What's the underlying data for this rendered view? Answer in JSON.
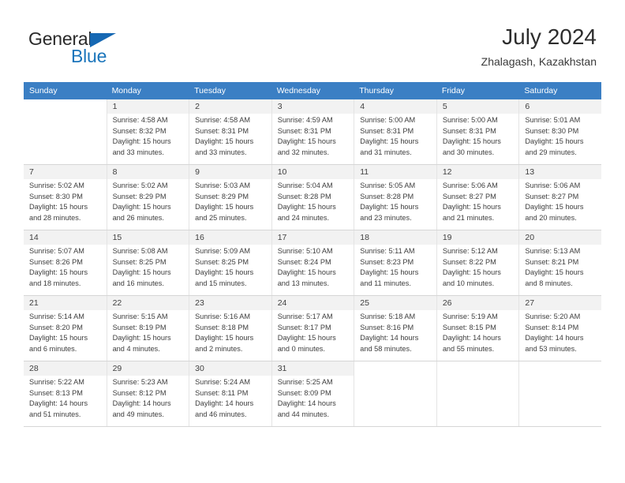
{
  "brand": {
    "name_part1": "General",
    "name_part2": "Blue",
    "accent_color": "#1b75bb",
    "triangle_icon": "logo-triangle-icon"
  },
  "header": {
    "title": "July 2024",
    "subtitle": "Zhalagash, Kazakhstan"
  },
  "calendar": {
    "header_bg": "#3b7fc4",
    "weekdays": [
      "Sunday",
      "Monday",
      "Tuesday",
      "Wednesday",
      "Thursday",
      "Friday",
      "Saturday"
    ],
    "weeks": [
      [
        {
          "day": "",
          "line1": "",
          "line2": "",
          "line3": "",
          "line4": ""
        },
        {
          "day": "1",
          "line1": "Sunrise: 4:58 AM",
          "line2": "Sunset: 8:32 PM",
          "line3": "Daylight: 15 hours",
          "line4": "and 33 minutes."
        },
        {
          "day": "2",
          "line1": "Sunrise: 4:58 AM",
          "line2": "Sunset: 8:31 PM",
          "line3": "Daylight: 15 hours",
          "line4": "and 33 minutes."
        },
        {
          "day": "3",
          "line1": "Sunrise: 4:59 AM",
          "line2": "Sunset: 8:31 PM",
          "line3": "Daylight: 15 hours",
          "line4": "and 32 minutes."
        },
        {
          "day": "4",
          "line1": "Sunrise: 5:00 AM",
          "line2": "Sunset: 8:31 PM",
          "line3": "Daylight: 15 hours",
          "line4": "and 31 minutes."
        },
        {
          "day": "5",
          "line1": "Sunrise: 5:00 AM",
          "line2": "Sunset: 8:31 PM",
          "line3": "Daylight: 15 hours",
          "line4": "and 30 minutes."
        },
        {
          "day": "6",
          "line1": "Sunrise: 5:01 AM",
          "line2": "Sunset: 8:30 PM",
          "line3": "Daylight: 15 hours",
          "line4": "and 29 minutes."
        }
      ],
      [
        {
          "day": "7",
          "line1": "Sunrise: 5:02 AM",
          "line2": "Sunset: 8:30 PM",
          "line3": "Daylight: 15 hours",
          "line4": "and 28 minutes."
        },
        {
          "day": "8",
          "line1": "Sunrise: 5:02 AM",
          "line2": "Sunset: 8:29 PM",
          "line3": "Daylight: 15 hours",
          "line4": "and 26 minutes."
        },
        {
          "day": "9",
          "line1": "Sunrise: 5:03 AM",
          "line2": "Sunset: 8:29 PM",
          "line3": "Daylight: 15 hours",
          "line4": "and 25 minutes."
        },
        {
          "day": "10",
          "line1": "Sunrise: 5:04 AM",
          "line2": "Sunset: 8:28 PM",
          "line3": "Daylight: 15 hours",
          "line4": "and 24 minutes."
        },
        {
          "day": "11",
          "line1": "Sunrise: 5:05 AM",
          "line2": "Sunset: 8:28 PM",
          "line3": "Daylight: 15 hours",
          "line4": "and 23 minutes."
        },
        {
          "day": "12",
          "line1": "Sunrise: 5:06 AM",
          "line2": "Sunset: 8:27 PM",
          "line3": "Daylight: 15 hours",
          "line4": "and 21 minutes."
        },
        {
          "day": "13",
          "line1": "Sunrise: 5:06 AM",
          "line2": "Sunset: 8:27 PM",
          "line3": "Daylight: 15 hours",
          "line4": "and 20 minutes."
        }
      ],
      [
        {
          "day": "14",
          "line1": "Sunrise: 5:07 AM",
          "line2": "Sunset: 8:26 PM",
          "line3": "Daylight: 15 hours",
          "line4": "and 18 minutes."
        },
        {
          "day": "15",
          "line1": "Sunrise: 5:08 AM",
          "line2": "Sunset: 8:25 PM",
          "line3": "Daylight: 15 hours",
          "line4": "and 16 minutes."
        },
        {
          "day": "16",
          "line1": "Sunrise: 5:09 AM",
          "line2": "Sunset: 8:25 PM",
          "line3": "Daylight: 15 hours",
          "line4": "and 15 minutes."
        },
        {
          "day": "17",
          "line1": "Sunrise: 5:10 AM",
          "line2": "Sunset: 8:24 PM",
          "line3": "Daylight: 15 hours",
          "line4": "and 13 minutes."
        },
        {
          "day": "18",
          "line1": "Sunrise: 5:11 AM",
          "line2": "Sunset: 8:23 PM",
          "line3": "Daylight: 15 hours",
          "line4": "and 11 minutes."
        },
        {
          "day": "19",
          "line1": "Sunrise: 5:12 AM",
          "line2": "Sunset: 8:22 PM",
          "line3": "Daylight: 15 hours",
          "line4": "and 10 minutes."
        },
        {
          "day": "20",
          "line1": "Sunrise: 5:13 AM",
          "line2": "Sunset: 8:21 PM",
          "line3": "Daylight: 15 hours",
          "line4": "and 8 minutes."
        }
      ],
      [
        {
          "day": "21",
          "line1": "Sunrise: 5:14 AM",
          "line2": "Sunset: 8:20 PM",
          "line3": "Daylight: 15 hours",
          "line4": "and 6 minutes."
        },
        {
          "day": "22",
          "line1": "Sunrise: 5:15 AM",
          "line2": "Sunset: 8:19 PM",
          "line3": "Daylight: 15 hours",
          "line4": "and 4 minutes."
        },
        {
          "day": "23",
          "line1": "Sunrise: 5:16 AM",
          "line2": "Sunset: 8:18 PM",
          "line3": "Daylight: 15 hours",
          "line4": "and 2 minutes."
        },
        {
          "day": "24",
          "line1": "Sunrise: 5:17 AM",
          "line2": "Sunset: 8:17 PM",
          "line3": "Daylight: 15 hours",
          "line4": "and 0 minutes."
        },
        {
          "day": "25",
          "line1": "Sunrise: 5:18 AM",
          "line2": "Sunset: 8:16 PM",
          "line3": "Daylight: 14 hours",
          "line4": "and 58 minutes."
        },
        {
          "day": "26",
          "line1": "Sunrise: 5:19 AM",
          "line2": "Sunset: 8:15 PM",
          "line3": "Daylight: 14 hours",
          "line4": "and 55 minutes."
        },
        {
          "day": "27",
          "line1": "Sunrise: 5:20 AM",
          "line2": "Sunset: 8:14 PM",
          "line3": "Daylight: 14 hours",
          "line4": "and 53 minutes."
        }
      ],
      [
        {
          "day": "28",
          "line1": "Sunrise: 5:22 AM",
          "line2": "Sunset: 8:13 PM",
          "line3": "Daylight: 14 hours",
          "line4": "and 51 minutes."
        },
        {
          "day": "29",
          "line1": "Sunrise: 5:23 AM",
          "line2": "Sunset: 8:12 PM",
          "line3": "Daylight: 14 hours",
          "line4": "and 49 minutes."
        },
        {
          "day": "30",
          "line1": "Sunrise: 5:24 AM",
          "line2": "Sunset: 8:11 PM",
          "line3": "Daylight: 14 hours",
          "line4": "and 46 minutes."
        },
        {
          "day": "31",
          "line1": "Sunrise: 5:25 AM",
          "line2": "Sunset: 8:09 PM",
          "line3": "Daylight: 14 hours",
          "line4": "and 44 minutes."
        },
        {
          "day": "",
          "line1": "",
          "line2": "",
          "line3": "",
          "line4": ""
        },
        {
          "day": "",
          "line1": "",
          "line2": "",
          "line3": "",
          "line4": ""
        },
        {
          "day": "",
          "line1": "",
          "line2": "",
          "line3": "",
          "line4": ""
        }
      ]
    ]
  }
}
